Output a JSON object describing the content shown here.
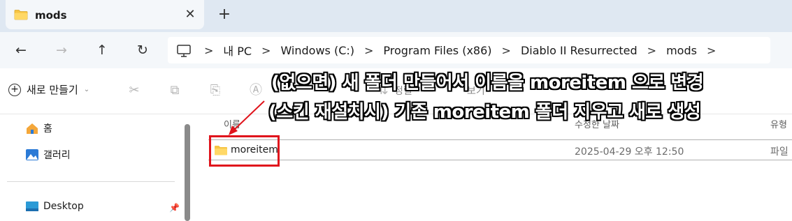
{
  "tab": {
    "title": "mods",
    "close_glyph": "✕",
    "new_tab_glyph": "+"
  },
  "nav": {
    "back_icon": "back-arrow-icon",
    "forward_icon": "forward-arrow-icon",
    "up_icon": "up-arrow-icon",
    "refresh_icon": "refresh-icon",
    "breadcrumbs": [
      "내 PC",
      "Windows (C:)",
      "Program Files (x86)",
      "Diablo II Resurrected",
      "mods"
    ],
    "separator": ">"
  },
  "toolbar": {
    "new_label": "새로 만들기",
    "sort_label": "정렬",
    "view_label": "보기"
  },
  "sidebar": {
    "items": [
      {
        "label": "홈",
        "icon": "home-icon"
      },
      {
        "label": "갤러리",
        "icon": "gallery-icon"
      },
      {
        "label": "Desktop",
        "icon": "desktop-icon"
      }
    ]
  },
  "filelist": {
    "columns": {
      "name": "이름",
      "date": "수정한 날짜",
      "type": "유형"
    },
    "rows": [
      {
        "name": "moreitem",
        "date": "2025-04-29 오후 12:50",
        "type": "파일"
      }
    ]
  },
  "annotation": {
    "line1": "(없으면) 새 폴더 만들어서 이름을 moreitem 으로 변경",
    "line2": "(스킨 재설치시) 기존 moreitem 폴더 지우고 새로 생성"
  },
  "colors": {
    "highlight": "#e0141c",
    "folder": "#f6c443",
    "tabbar": "#dfe8f2"
  }
}
